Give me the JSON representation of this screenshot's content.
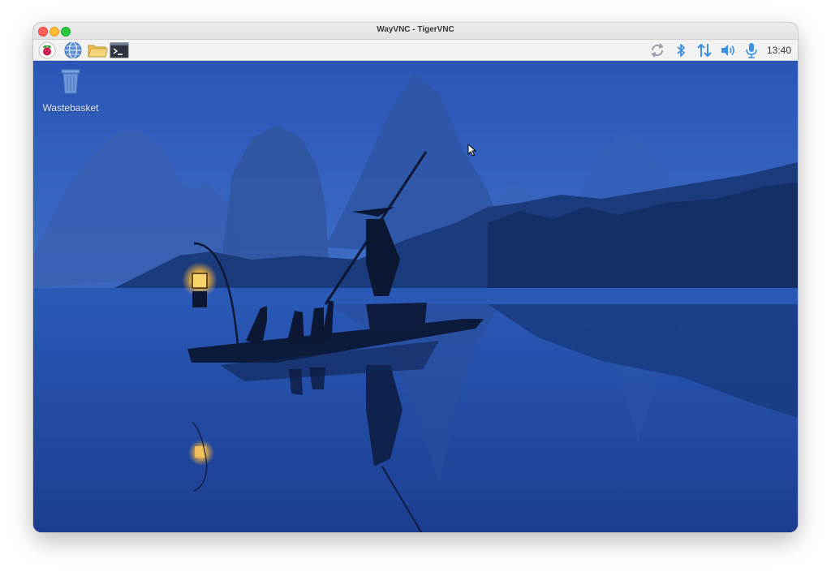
{
  "window": {
    "title": "WayVNC - TigerVNC"
  },
  "taskbar": {
    "launchers": [
      {
        "name": "raspberry-pi-menu-icon"
      },
      {
        "name": "web-browser-icon"
      },
      {
        "name": "file-manager-icon"
      },
      {
        "name": "terminal-icon"
      }
    ],
    "tray": [
      {
        "name": "sync-icon"
      },
      {
        "name": "bluetooth-icon"
      },
      {
        "name": "network-icon"
      },
      {
        "name": "volume-icon"
      },
      {
        "name": "microphone-icon"
      }
    ],
    "clock": "13:40",
    "accent_color": "#3d8fe0"
  },
  "desktop": {
    "icons": [
      {
        "label": "Wastebasket",
        "icon": "wastebasket-icon"
      }
    ]
  }
}
